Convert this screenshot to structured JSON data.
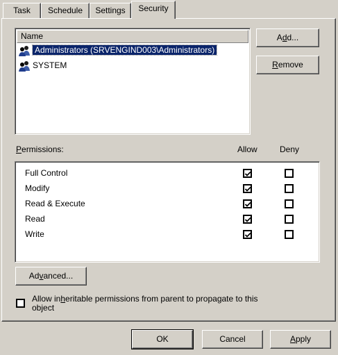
{
  "tabs": [
    "Task",
    "Schedule",
    "Settings",
    "Security"
  ],
  "active_tab": "Security",
  "names_list": {
    "header": "Name",
    "items": [
      {
        "text": "Administrators (SRVENGIND003\\Administrators)",
        "selected": true,
        "icon": "user-group-icon"
      },
      {
        "text": "SYSTEM",
        "selected": false,
        "icon": "user-group-icon"
      }
    ]
  },
  "buttons": {
    "add": {
      "pre": "A",
      "accel": "d",
      "post": "d..."
    },
    "remove": {
      "pre": "",
      "accel": "R",
      "post": "emove"
    },
    "advanced": {
      "pre": "Ad",
      "accel": "v",
      "post": "anced..."
    },
    "ok": "OK",
    "cancel": "Cancel",
    "apply": {
      "pre": "",
      "accel": "A",
      "post": "pply"
    }
  },
  "permissions": {
    "label": {
      "pre": "",
      "accel": "P",
      "post": "ermissions:"
    },
    "allow_header": "Allow",
    "deny_header": "Deny",
    "rows": [
      {
        "name": "Full Control",
        "allow": true,
        "deny": false
      },
      {
        "name": "Modify",
        "allow": true,
        "deny": false
      },
      {
        "name": "Read & Execute",
        "allow": true,
        "deny": false
      },
      {
        "name": "Read",
        "allow": true,
        "deny": false
      },
      {
        "name": "Write",
        "allow": true,
        "deny": false
      }
    ]
  },
  "inherit": {
    "line1_pre": "Allow in",
    "line1_accel": "h",
    "line1_post": "eritable permissions from parent to propagate to this",
    "line2": "object",
    "checked": false
  }
}
